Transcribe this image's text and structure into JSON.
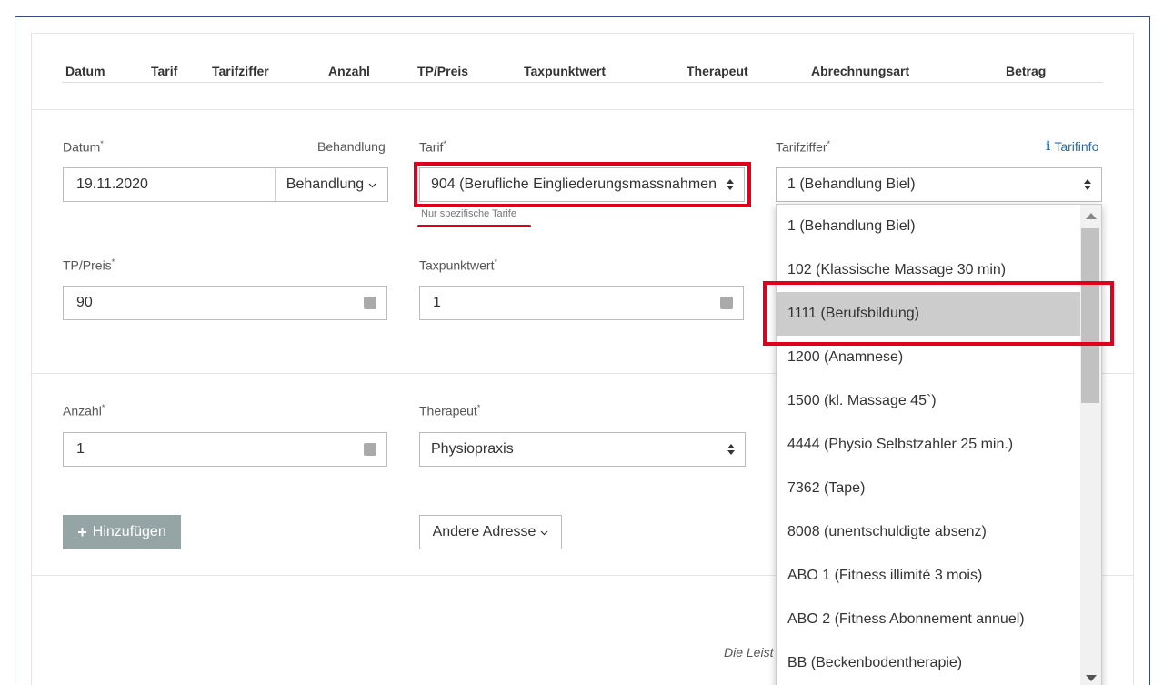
{
  "table_header": {
    "columns": [
      "Datum",
      "Tarif",
      "Tarifziffer",
      "Anzahl",
      "TP/Preis",
      "Taxpunktwert",
      "Therapeut",
      "Abrechnungsart",
      "Betrag"
    ]
  },
  "form": {
    "datum_label": "Datum",
    "behandlung_label": "Behandlung",
    "datum_value": "19.11.2020",
    "behandlung_button": "Behandlung",
    "tarif_label": "Tarif",
    "tarif_value": "904 (Berufliche Eingliederungsmassnahmen",
    "tarif_hint": "Nur spezifische Tarife",
    "tarifziffer_label": "Tarifziffer",
    "tarifinfo_link": "Tarifinfo",
    "tarifziffer_value": "1 (Behandlung Biel)",
    "tp_preis_label": "TP/Preis",
    "tp_preis_value": "90",
    "taxpunktwert_label": "Taxpunktwert",
    "taxpunktwert_value": "1",
    "anzahl_label": "Anzahl",
    "anzahl_value": "1",
    "therapeut_label": "Therapeut",
    "therapeut_value": "Physiopraxis",
    "add_button": "Hinzufügen",
    "address_button": "Andere Adresse",
    "footer_text": "Die Leist"
  },
  "dropdown": {
    "options": [
      "1 (Behandlung Biel)",
      "102 (Klassische Massage 30 min)",
      "1111 (Berufsbildung)",
      "1200 (Anamnese)",
      "1500 (kl. Massage 45`)",
      "4444 (Physio Selbstzahler 25 min.)",
      "7362 (Tape)",
      "8008 (unentschuldigte absenz)",
      "ABO 1 (Fitness illimité 3 mois)",
      "ABO 2 (Fitness Abonnement annuel)",
      "BB (Beckenbodentherapie)"
    ],
    "highlighted_option": "1111 (Berufsbildung)"
  },
  "colors": {
    "highlight_red": "#e0001b",
    "add_button_bg": "#95a5a6",
    "link_blue": "#2a6aa8",
    "selected_option_bg": "#cccccc"
  }
}
